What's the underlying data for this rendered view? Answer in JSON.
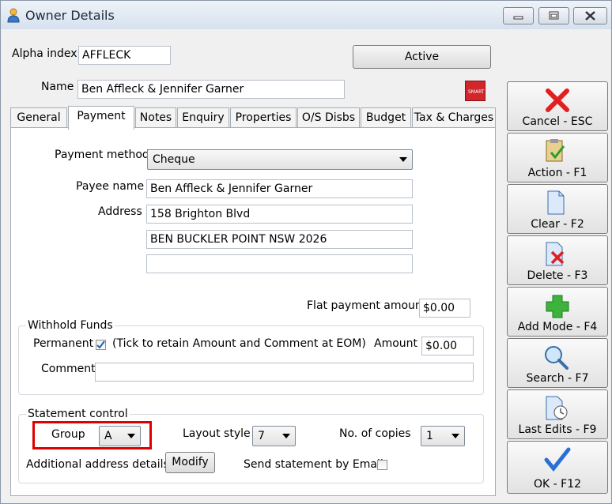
{
  "window": {
    "title": "Owner Details"
  },
  "header": {
    "alpha_index_label": "Alpha index",
    "alpha_index_value": "AFFLECK",
    "status_button": "Active",
    "name_label": "Name",
    "name_value": "Ben Affleck & Jennifer Garner",
    "smart_label": "SMART"
  },
  "tabs": [
    "General",
    "Payment",
    "Notes",
    "Enquiry",
    "Properties",
    "O/S Disbs",
    "Budget",
    "Tax & Charges"
  ],
  "payment": {
    "method_label": "Payment method",
    "method_value": "Cheque",
    "payee_label": "Payee name",
    "payee_value": "Ben Affleck & Jennifer Garner",
    "address_label": "Address",
    "address_lines": [
      "158 Brighton Blvd",
      "BEN BUCKLER POINT NSW 2026",
      ""
    ],
    "flat_label": "Flat payment amount",
    "flat_value": "$0.00"
  },
  "withhold": {
    "title": "Withhold Funds",
    "permanent_label": "Permanent",
    "permanent_checked": true,
    "permanent_note": "(Tick to retain Amount and Comment at EOM)",
    "amount_label": "Amount",
    "amount_value": "$0.00",
    "comment_label": "Comment",
    "comment_value": ""
  },
  "statement": {
    "title": "Statement control",
    "group_label": "Group",
    "group_value": "A",
    "layout_label": "Layout style",
    "layout_value": "7",
    "copies_label": "No. of copies",
    "copies_value": "1",
    "additional_label": "Additional address details",
    "modify_button": "Modify",
    "email_label": "Send statement by Email",
    "email_checked": false
  },
  "actions": [
    {
      "label": "Cancel - ESC",
      "icon": "red-x-icon"
    },
    {
      "label": "Action - F1",
      "icon": "clipboard-check-icon"
    },
    {
      "label": "Clear - F2",
      "icon": "blank-page-icon"
    },
    {
      "label": "Delete - F3",
      "icon": "delete-page-icon"
    },
    {
      "label": "Add Mode - F4",
      "icon": "green-plus-icon"
    },
    {
      "label": "Search - F7",
      "icon": "magnifier-icon"
    },
    {
      "label": "Last Edits - F9",
      "icon": "page-clock-icon"
    },
    {
      "label": "OK - F12",
      "icon": "checkmark-icon"
    }
  ],
  "colors": {
    "highlight": "#e00000",
    "cancel": "#e02020",
    "add": "#2e9e2e",
    "ok": "#2a6fd6"
  }
}
